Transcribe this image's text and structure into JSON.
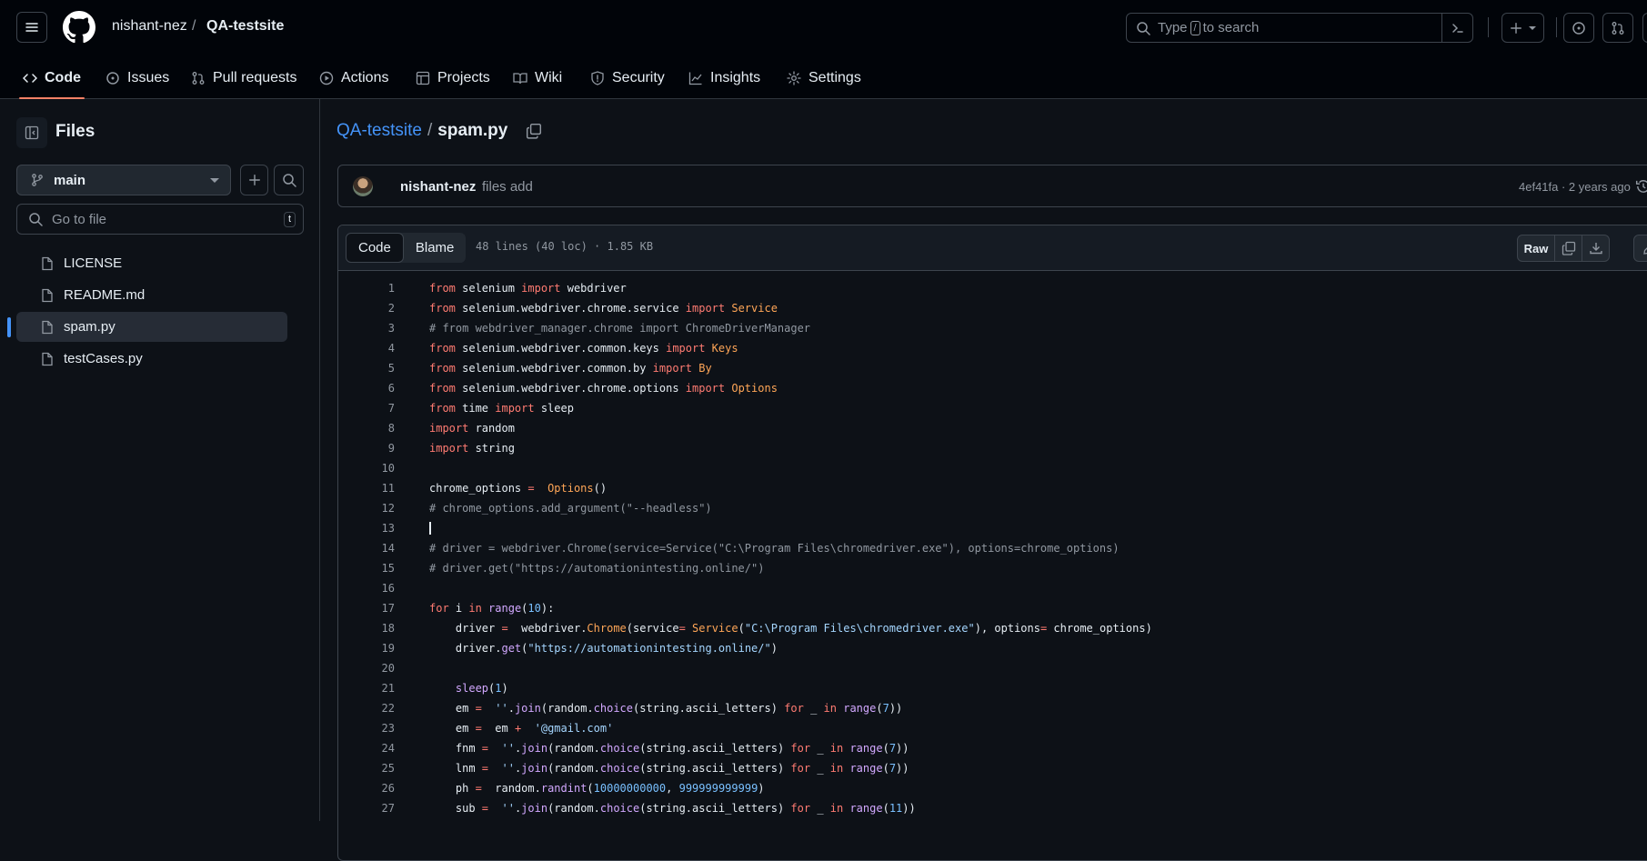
{
  "header": {
    "owner": "nishant-nez",
    "separator": "/",
    "repo": "QA-testsite",
    "search_prefix": "Type",
    "search_key": "/",
    "search_suffix": "to search"
  },
  "tabs": [
    {
      "label": "Code",
      "icon": "code-icon"
    },
    {
      "label": "Issues",
      "icon": "issue-icon"
    },
    {
      "label": "Pull requests",
      "icon": "pull-request-icon"
    },
    {
      "label": "Actions",
      "icon": "play-icon"
    },
    {
      "label": "Projects",
      "icon": "table-icon"
    },
    {
      "label": "Wiki",
      "icon": "book-icon"
    },
    {
      "label": "Security",
      "icon": "shield-icon"
    },
    {
      "label": "Insights",
      "icon": "graph-icon"
    },
    {
      "label": "Settings",
      "icon": "gear-icon"
    }
  ],
  "sidebar": {
    "title": "Files",
    "branch": "main",
    "goto_placeholder": "Go to file",
    "goto_shortcut": "t",
    "files": [
      {
        "name": "LICENSE"
      },
      {
        "name": "README.md"
      },
      {
        "name": "spam.py",
        "selected": true
      },
      {
        "name": "testCases.py"
      }
    ]
  },
  "file": {
    "repo_link": "QA-testsite",
    "sep": "/",
    "name": "spam.py",
    "commit_author": "nishant-nez",
    "commit_message": "files add",
    "commit_meta": "4ef41fa · 2 years ago",
    "view_code": "Code",
    "view_blame": "Blame",
    "info": "48 lines (40 loc) · 1.85 KB",
    "raw_label": "Raw"
  },
  "colors": {
    "accent_tab": "#f78166",
    "link": "#4493f8",
    "keyword": "#ff7b72",
    "class": "#ffa657",
    "function": "#d2a8ff",
    "string": "#a5d6ff",
    "number": "#79c0ff"
  },
  "code_lines": [
    [
      [
        "kw",
        "from"
      ],
      [
        "",
        "selenium "
      ],
      [
        "kw",
        "import"
      ],
      [
        "",
        "webdriver"
      ]
    ],
    [
      [
        "kw",
        "from"
      ],
      [
        "",
        "selenium.webdriver.chrome.service "
      ],
      [
        "kw",
        "import"
      ],
      [
        "cls",
        "Service"
      ]
    ],
    [
      [
        "cm",
        "# from webdriver_manager.chrome import ChromeDriverManager"
      ]
    ],
    [
      [
        "kw",
        "from"
      ],
      [
        "",
        "selenium.webdriver.common.keys "
      ],
      [
        "kw",
        "import"
      ],
      [
        "cls",
        "Keys"
      ]
    ],
    [
      [
        "kw",
        "from"
      ],
      [
        "",
        "selenium.webdriver.common.by "
      ],
      [
        "kw",
        "import"
      ],
      [
        "cls",
        "By"
      ]
    ],
    [
      [
        "kw",
        "from"
      ],
      [
        "",
        "selenium.webdriver.chrome.options "
      ],
      [
        "kw",
        "import"
      ],
      [
        "cls",
        "Options"
      ]
    ],
    [
      [
        "kw",
        "from"
      ],
      [
        "",
        "time "
      ],
      [
        "kw",
        "import"
      ],
      [
        "",
        "sleep"
      ]
    ],
    [
      [
        "kw",
        "import"
      ],
      [
        "",
        "random"
      ]
    ],
    [
      [
        "kw",
        "import"
      ],
      [
        "",
        "string"
      ]
    ],
    [],
    [
      [
        "",
        "chrome_options "
      ],
      [
        "kw",
        "="
      ],
      [
        "",
        "  "
      ],
      [
        "cls",
        "Options"
      ],
      [
        "",
        "()"
      ]
    ],
    [
      [
        "cm",
        "# chrome_options.add_argument(\"--headless\")"
      ]
    ],
    [
      [
        "caret",
        ""
      ]
    ],
    [
      [
        "cm",
        "# driver = webdriver.Chrome(service=Service(\"C:\\Program Files\\chromedriver.exe\"), options=chrome_options)"
      ]
    ],
    [
      [
        "cm",
        "# driver.get(\"https://automationintesting.online/\")"
      ]
    ],
    [],
    [
      [
        "kw",
        "for"
      ],
      [
        "",
        "i "
      ],
      [
        "kw",
        "in"
      ],
      [
        "fn",
        "range"
      ],
      [
        "",
        "("
      ],
      [
        "num",
        "10"
      ],
      [
        "",
        "):"
      ]
    ],
    [
      [
        "",
        "    driver "
      ],
      [
        "kw",
        "="
      ],
      [
        "",
        "  webdriver."
      ],
      [
        "cls",
        "Chrome"
      ],
      [
        "",
        "(service"
      ],
      [
        "kw",
        "="
      ],
      [
        "cls",
        "Service"
      ],
      [
        "",
        "("
      ],
      [
        "str",
        "\"C:\\Program Files\\chromedriver.exe\""
      ],
      [
        "",
        "), options"
      ],
      [
        "kw",
        "="
      ],
      [
        "",
        "chrome_options)"
      ]
    ],
    [
      [
        "",
        "    driver."
      ],
      [
        "fn",
        "get"
      ],
      [
        "",
        "("
      ],
      [
        "str",
        "\"https://automationintesting.online/\""
      ],
      [
        "",
        ")"
      ]
    ],
    [],
    [
      [
        "",
        "    "
      ],
      [
        "fn",
        "sleep"
      ],
      [
        "",
        "("
      ],
      [
        "num",
        "1"
      ],
      [
        "",
        ")"
      ]
    ],
    [
      [
        "",
        "    em "
      ],
      [
        "kw",
        "="
      ],
      [
        "",
        "  "
      ],
      [
        "str",
        "''"
      ],
      [
        "",
        "."
      ],
      [
        "fn",
        "join"
      ],
      [
        "",
        "(random."
      ],
      [
        "fn",
        "choice"
      ],
      [
        "",
        "(string.ascii_letters) "
      ],
      [
        "kw",
        "for"
      ],
      [
        "",
        "_ "
      ],
      [
        "kw",
        "in"
      ],
      [
        "fn",
        "range"
      ],
      [
        "",
        "("
      ],
      [
        "num",
        "7"
      ],
      [
        "",
        "))"
      ]
    ],
    [
      [
        "",
        "    em "
      ],
      [
        "kw",
        "="
      ],
      [
        "",
        "  em "
      ],
      [
        "kw",
        "+"
      ],
      [
        "",
        "  "
      ],
      [
        "str",
        "'@gmail.com'"
      ]
    ],
    [
      [
        "",
        "    fnm "
      ],
      [
        "kw",
        "="
      ],
      [
        "",
        "  "
      ],
      [
        "str",
        "''"
      ],
      [
        "",
        "."
      ],
      [
        "fn",
        "join"
      ],
      [
        "",
        "(random."
      ],
      [
        "fn",
        "choice"
      ],
      [
        "",
        "(string.ascii_letters) "
      ],
      [
        "kw",
        "for"
      ],
      [
        "",
        "_ "
      ],
      [
        "kw",
        "in"
      ],
      [
        "fn",
        "range"
      ],
      [
        "",
        "("
      ],
      [
        "num",
        "7"
      ],
      [
        "",
        "))"
      ]
    ],
    [
      [
        "",
        "    lnm "
      ],
      [
        "kw",
        "="
      ],
      [
        "",
        "  "
      ],
      [
        "str",
        "''"
      ],
      [
        "",
        "."
      ],
      [
        "fn",
        "join"
      ],
      [
        "",
        "(random."
      ],
      [
        "fn",
        "choice"
      ],
      [
        "",
        "(string.ascii_letters) "
      ],
      [
        "kw",
        "for"
      ],
      [
        "",
        "_ "
      ],
      [
        "kw",
        "in"
      ],
      [
        "fn",
        "range"
      ],
      [
        "",
        "("
      ],
      [
        "num",
        "7"
      ],
      [
        "",
        "))"
      ]
    ],
    [
      [
        "",
        "    ph "
      ],
      [
        "kw",
        "="
      ],
      [
        "",
        "  random."
      ],
      [
        "fn",
        "randint"
      ],
      [
        "",
        "("
      ],
      [
        "num",
        "10000000000"
      ],
      [
        "",
        ", "
      ],
      [
        "num",
        "999999999999"
      ],
      [
        "",
        ")"
      ]
    ],
    [
      [
        "",
        "    sub "
      ],
      [
        "kw",
        "="
      ],
      [
        "",
        "  "
      ],
      [
        "str",
        "''"
      ],
      [
        "",
        "."
      ],
      [
        "fn",
        "join"
      ],
      [
        "",
        "(random."
      ],
      [
        "fn",
        "choice"
      ],
      [
        "",
        "(string.ascii_letters) "
      ],
      [
        "kw",
        "for"
      ],
      [
        "",
        "_ "
      ],
      [
        "kw",
        "in"
      ],
      [
        "fn",
        "range"
      ],
      [
        "",
        "("
      ],
      [
        "num",
        "11"
      ],
      [
        "",
        "))"
      ]
    ]
  ]
}
